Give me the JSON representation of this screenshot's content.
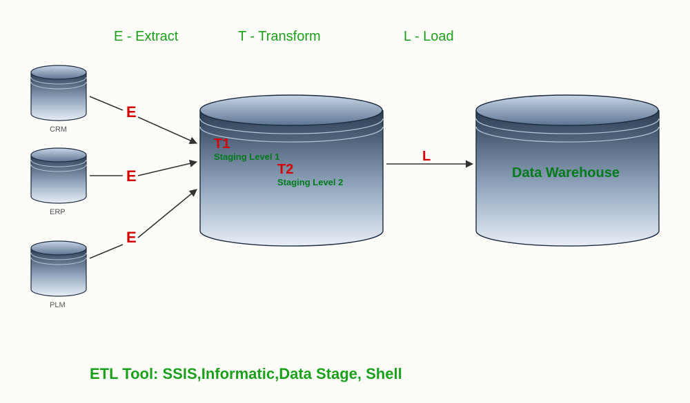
{
  "header": {
    "extract": "E - Extract",
    "transform": "T - Transform",
    "load": "L - Load"
  },
  "sources": {
    "crm": "CRM",
    "erp": "ERP",
    "plm": "PLM"
  },
  "stage_markers": {
    "e1": "E",
    "e2": "E",
    "e3": "E",
    "t1": "T1",
    "t2": "T2",
    "l": "L"
  },
  "staging": {
    "level1": "Staging Level 1",
    "level2": "Staging Level 2"
  },
  "warehouse": {
    "label": "Data Warehouse"
  },
  "footer": {
    "tools": "ETL Tool: SSIS,Informatic,Data Stage, Shell"
  }
}
